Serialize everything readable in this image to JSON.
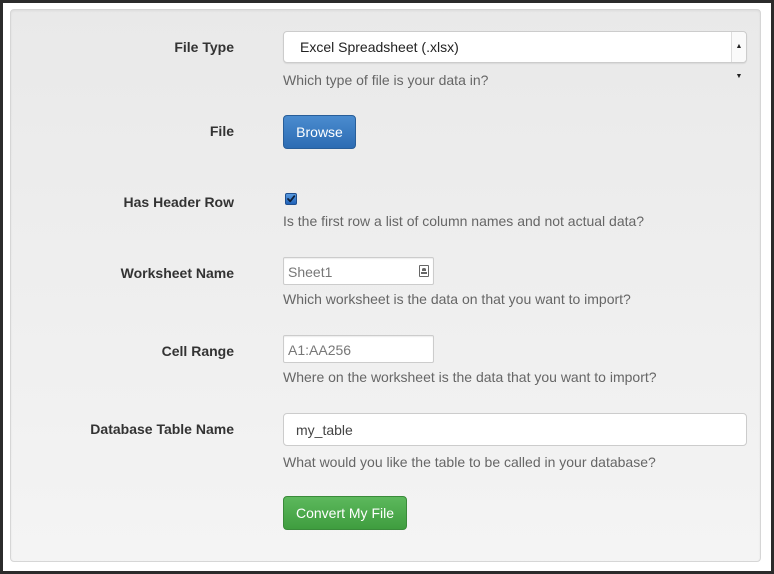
{
  "form": {
    "file_type": {
      "label": "File Type",
      "selected": "Excel Spreadsheet (.xlsx)",
      "help": "Which type of file is your data in?"
    },
    "file": {
      "label": "File",
      "button": "Browse"
    },
    "header_row": {
      "label": "Has Header Row",
      "checked": true,
      "help": "Is the first row a list of column names and not actual data?"
    },
    "worksheet": {
      "label": "Worksheet Name",
      "placeholder": "Sheet1",
      "help": "Which worksheet is the data on that you want to import?"
    },
    "cell_range": {
      "label": "Cell Range",
      "placeholder": "A1:AA256",
      "help": "Where on the worksheet is the data that you want to import?"
    },
    "table_name": {
      "label": "Database Table Name",
      "value": "my_table",
      "help": "What would you like the table to be called in your database?"
    },
    "submit": "Convert My File"
  },
  "colors": {
    "primary": "#2c6cb3",
    "success": "#4cae4c"
  },
  "icons": {
    "select_arrow": "up-down-arrows-icon",
    "worksheet_field": "contact-card-icon",
    "checkbox": "checkmark-icon"
  }
}
